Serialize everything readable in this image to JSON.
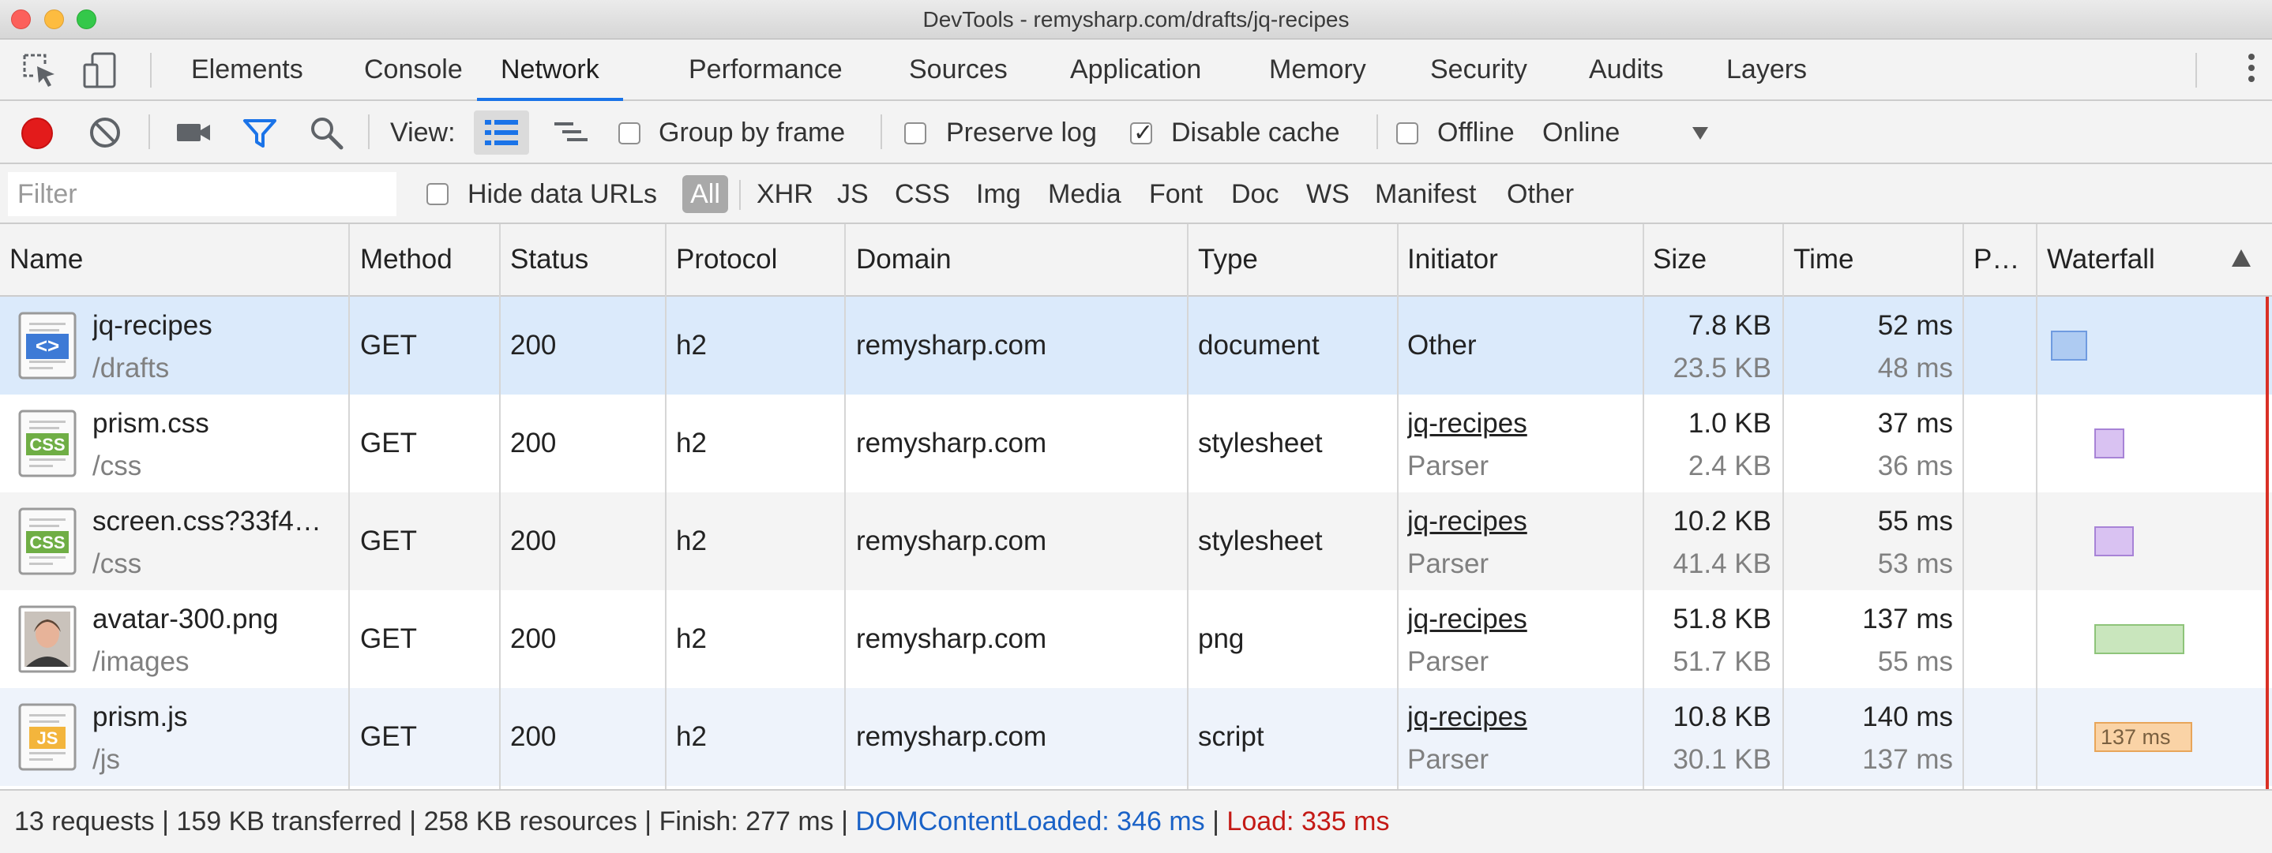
{
  "window": {
    "title": "DevTools - remysharp.com/drafts/jq-recipes"
  },
  "tabs": [
    "Elements",
    "Console",
    "Network",
    "Performance",
    "Sources",
    "Application",
    "Memory",
    "Security",
    "Audits",
    "Layers"
  ],
  "active_tab": "Network",
  "toolbar": {
    "view_label": "View:",
    "group_by_frame": {
      "label": "Group by frame",
      "checked": false
    },
    "preserve_log": {
      "label": "Preserve log",
      "checked": false
    },
    "disable_cache": {
      "label": "Disable cache",
      "checked": true
    },
    "offline": {
      "label": "Offline",
      "checked": false
    },
    "throttling": "Online"
  },
  "filter": {
    "placeholder": "Filter",
    "hide_data_urls": {
      "label": "Hide data URLs",
      "checked": false
    },
    "types": [
      "All",
      "XHR",
      "JS",
      "CSS",
      "Img",
      "Media",
      "Font",
      "Doc",
      "WS",
      "Manifest",
      "Other"
    ],
    "selected_type": "All"
  },
  "columns": [
    "Name",
    "Method",
    "Status",
    "Protocol",
    "Domain",
    "Type",
    "Initiator",
    "Size",
    "Time",
    "P…",
    "Waterfall"
  ],
  "rows": [
    {
      "name": "jq-recipes",
      "path": "/drafts",
      "method": "GET",
      "status": "200",
      "protocol": "h2",
      "domain": "remysharp.com",
      "type": "document",
      "initiator": "Other",
      "initiator_sub": "",
      "size": "7.8 KB",
      "resource_size": "23.5 KB",
      "time": "52 ms",
      "latency": "48 ms",
      "icon": "html-file-icon"
    },
    {
      "name": "prism.css",
      "path": "/css",
      "method": "GET",
      "status": "200",
      "protocol": "h2",
      "domain": "remysharp.com",
      "type": "stylesheet",
      "initiator": "jq-recipes",
      "initiator_sub": "Parser",
      "size": "1.0 KB",
      "resource_size": "2.4 KB",
      "time": "37 ms",
      "latency": "36 ms",
      "icon": "css-file-icon"
    },
    {
      "name": "screen.css?33f4…",
      "path": "/css",
      "method": "GET",
      "status": "200",
      "protocol": "h2",
      "domain": "remysharp.com",
      "type": "stylesheet",
      "initiator": "jq-recipes",
      "initiator_sub": "Parser",
      "size": "10.2 KB",
      "resource_size": "41.4 KB",
      "time": "55 ms",
      "latency": "53 ms",
      "icon": "css-file-icon"
    },
    {
      "name": "avatar-300.png",
      "path": "/images",
      "method": "GET",
      "status": "200",
      "protocol": "h2",
      "domain": "remysharp.com",
      "type": "png",
      "initiator": "jq-recipes",
      "initiator_sub": "Parser",
      "size": "51.8 KB",
      "resource_size": "51.7 KB",
      "time": "137 ms",
      "latency": "55 ms",
      "icon": "image-thumbnail-icon"
    },
    {
      "name": "prism.js",
      "path": "/js",
      "method": "GET",
      "status": "200",
      "protocol": "h2",
      "domain": "remysharp.com",
      "type": "script",
      "initiator": "jq-recipes",
      "initiator_sub": "Parser",
      "size": "10.8 KB",
      "resource_size": "30.1 KB",
      "time": "140 ms",
      "latency": "137 ms",
      "icon": "js-file-icon"
    }
  ],
  "waterfall": {
    "bar_label": "137 ms",
    "colors": {
      "document": "#aecbf2",
      "stylesheet": "#d9c2f2",
      "image": "#c9e6bd",
      "script": "#fad3a6",
      "load_line": "#d93025"
    }
  },
  "status": {
    "requests": "13 requests",
    "transferred": "159 KB transferred",
    "resources": "258 KB resources",
    "finish": "Finish: 277 ms",
    "dom_content_loaded": "DOMContentLoaded: 346 ms",
    "load": "Load: 335 ms",
    "separator": "|"
  }
}
